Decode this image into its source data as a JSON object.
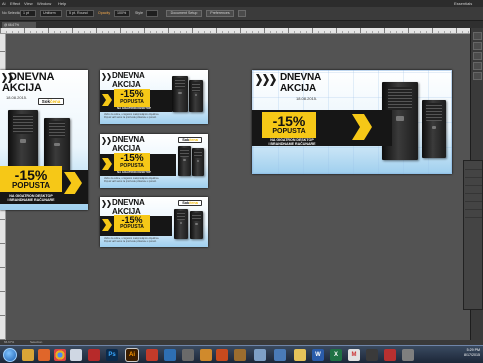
{
  "menu": {
    "items": [
      "Ai",
      "Effect",
      "View",
      "Window",
      "Help"
    ],
    "workspace": "Essentials"
  },
  "control_bar": {
    "selection": "No Selection",
    "stroke_weight": "1 pt",
    "brush": "Uniform",
    "style": "5 pt. Round",
    "opacity_label": "Opacity",
    "opacity_value": "100%",
    "style_label": "Style",
    "document_setup": "Document Setup",
    "preferences": "Preferences"
  },
  "document_tab": {
    "title": "@ 66.67% (CMYK/Preview)"
  },
  "status_bar": {
    "zoom": "66.67%",
    "tool": "Selection"
  },
  "banners": {
    "title_line1": "DNEVNA",
    "title_line2": "AKCIJA",
    "date": "18.08.2015.",
    "logo_a": "Sok",
    "logo_b": "čena",
    "discount": "-15%",
    "discount_word": "POPUSTA",
    "subtitle_line1": "NA GIGATRON DESKTOP",
    "subtitle_line2": "I BRANDNAME RAČUNARE",
    "fine_print": "Važno za online, u Gigatron maloprodajnim objektima.\nPopust važi samo za proizvode prikazane u ponudi."
  },
  "taskbar": {
    "time": "5:29 PM",
    "date": "8/17/2015",
    "apps": [
      "explorer",
      "firefox",
      "chrome",
      "photoshop",
      "illustrator",
      "acrobat",
      "word",
      "excel",
      "outlook",
      "skype",
      "media",
      "paint",
      "notepad",
      "calculator",
      "folder",
      "word-2",
      "excel-2",
      "gmail",
      "close"
    ]
  },
  "colors": {
    "accent": "#f6c817",
    "dark": "#161616",
    "bg": "#535353"
  }
}
